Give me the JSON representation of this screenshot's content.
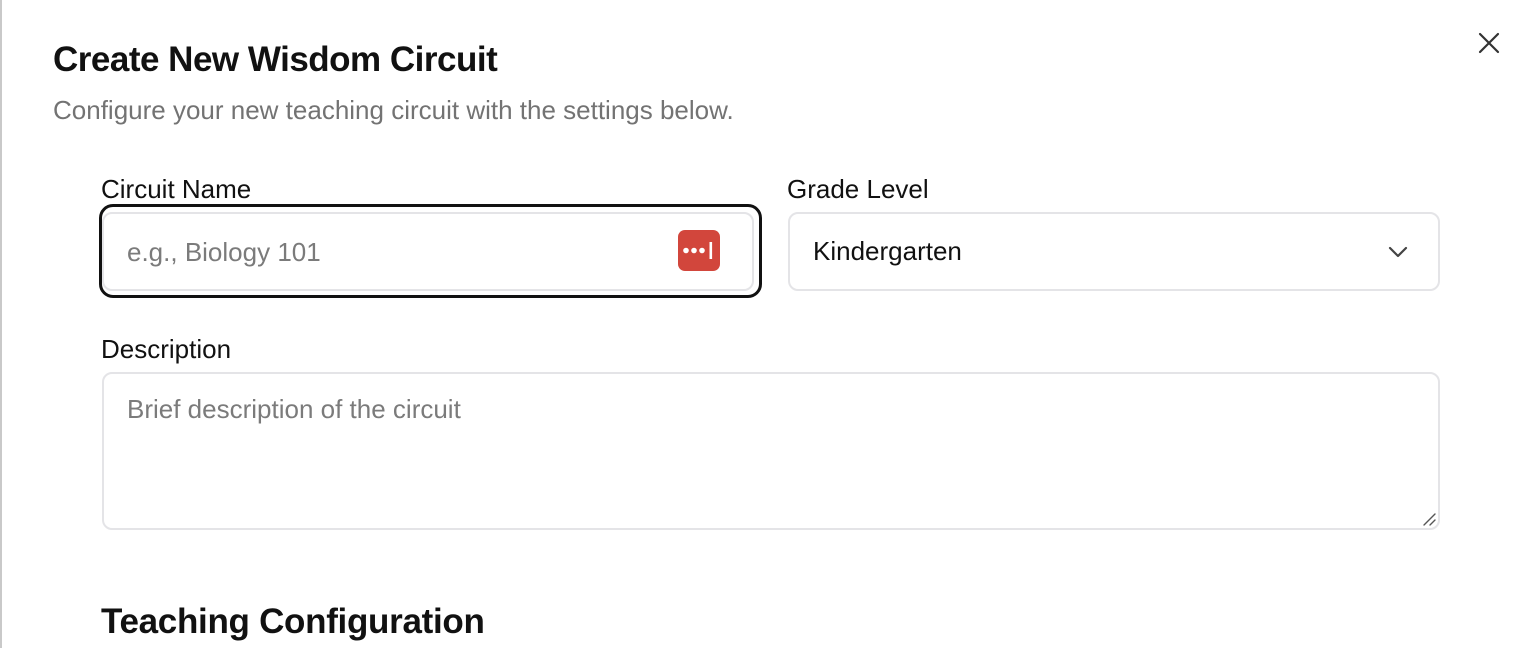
{
  "dialog": {
    "title": "Create New Wisdom Circuit",
    "subtitle": "Configure your new teaching circuit with the settings below."
  },
  "form": {
    "circuit_name": {
      "label": "Circuit Name",
      "placeholder": "e.g., Biology 101",
      "value": ""
    },
    "grade_level": {
      "label": "Grade Level",
      "selected": "Kindergarten"
    },
    "description": {
      "label": "Description",
      "placeholder": "Brief description of the circuit",
      "value": ""
    }
  },
  "sections": {
    "teaching_configuration": "Teaching Configuration"
  },
  "icons": {
    "close": "close-icon",
    "password_manager": "password-manager-icon",
    "dropdown": "chevron-down-icon",
    "resize": "resize-handle-icon"
  },
  "colors": {
    "password_manager_badge": "#d2463c",
    "focus_ring": "#111111"
  }
}
